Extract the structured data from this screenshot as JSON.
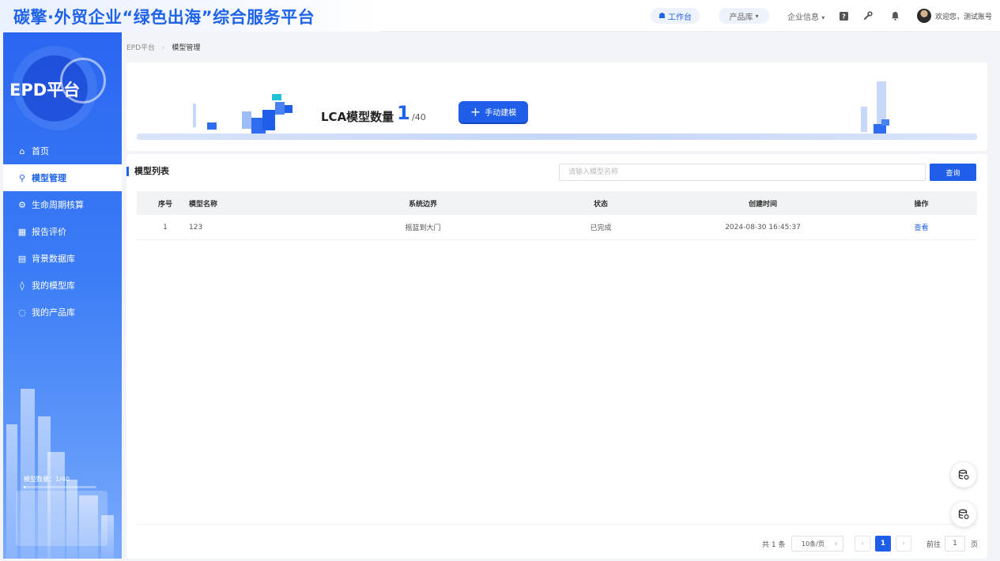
{
  "header": {
    "title": "碳擎·外贸企业“绿色出海”综合服务平台",
    "workbench": "工作台",
    "products_menu": "产品库",
    "company_menu": "企业信息",
    "welcome": "欢迎您，测试账号",
    "icons": [
      "home-icon",
      "help-icon",
      "wrench-icon",
      "bell-icon"
    ]
  },
  "sidebar": {
    "logo_text": "EPD平台",
    "items": [
      {
        "label": "首页",
        "icon": "home-icon",
        "active": false
      },
      {
        "label": "模型管理",
        "icon": "model-icon",
        "active": true
      },
      {
        "label": "生命周期核算",
        "icon": "lifecycle-icon",
        "active": false
      },
      {
        "label": "报告评价",
        "icon": "report-icon",
        "active": false
      },
      {
        "label": "背景数据库",
        "icon": "database-icon",
        "active": false
      },
      {
        "label": "我的模型库",
        "icon": "cube-icon",
        "active": false
      },
      {
        "label": "我的产品库",
        "icon": "box-icon",
        "active": false
      }
    ],
    "model_count_label": "模型数量：1/40",
    "model_count_fraction": 0.025
  },
  "breadcrumb": {
    "root": "EPD平台",
    "current": "模型管理"
  },
  "hero": {
    "title": "LCA模型数量",
    "count": "1",
    "max": "/40",
    "build_button": "手动建模"
  },
  "list": {
    "title": "模型列表",
    "search_placeholder": "请输入模型名称",
    "search_value": "",
    "search_button": "查询",
    "columns": [
      "序号",
      "模型名称",
      "系统边界",
      "状态",
      "创建时间",
      "操作"
    ],
    "rows": [
      {
        "idx": "1",
        "name": "123",
        "boundary": "摇篮到大门",
        "status": "已完成",
        "created": "2024-08-30 16:45:37",
        "action": "查看"
      }
    ]
  },
  "pagination": {
    "total": "共 1 条",
    "page_size": "10条/页",
    "current_page": "1",
    "goto_label": "前往",
    "goto_value": "1",
    "page_unit": "页"
  },
  "colors": {
    "accent": "#1f63e8",
    "sidebar": "#2a66f0"
  }
}
